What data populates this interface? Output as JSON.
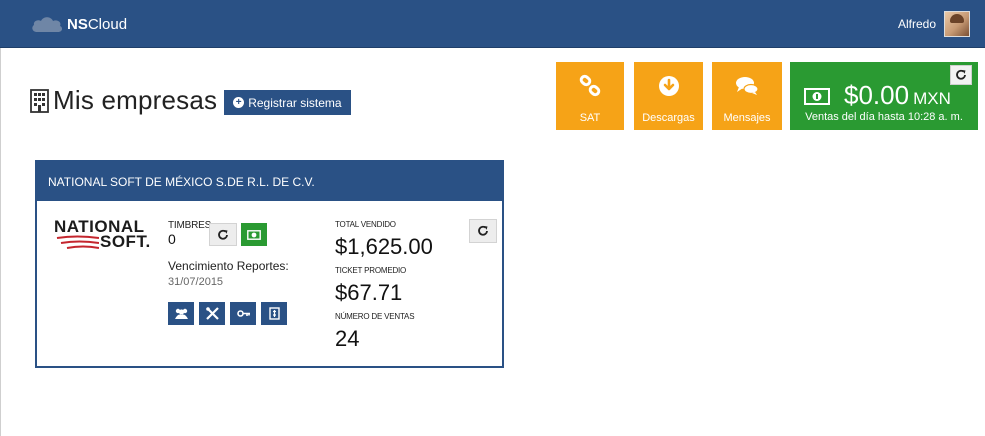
{
  "header": {
    "brand_prefix": "NS",
    "brand_suffix": "Cloud",
    "user_name": "Alfredo",
    "brand_color": "#2a5185"
  },
  "page": {
    "title": "Mis empresas",
    "register_button": "Registrar sistema"
  },
  "tiles": {
    "sat_label": "SAT",
    "downloads_label": "Descargas",
    "messages_label": "Mensajes",
    "tile_color": "#f6a317",
    "sales": {
      "amount": "$0.00",
      "currency": "MXN",
      "caption": "Ventas del día hasta 10:28 a. m.",
      "refresh_glyph": "C",
      "color": "#2a9a32"
    }
  },
  "company": {
    "name": "NATIONAL SOFT DE MÉXICO S.DE R.L. DE C.V.",
    "logo_top": "NATIONAL",
    "logo_bottom": "SOFT.",
    "timbres_label": "TIMBRES",
    "timbres_value": "0",
    "refresh_glyph": "C",
    "vencimiento_label": "Vencimiento Reportes:",
    "vencimiento_date": "31/07/2015",
    "total_vendido_label": "TOTAL VENDIDO",
    "total_vendido_value": "$1,625.00",
    "ticket_promedio_label": "TICKET PROMEDIO",
    "ticket_promedio_value": "$67.71",
    "numero_ventas_label": "NÚMERO DE VENTAS",
    "numero_ventas_value": "24",
    "action_icons": [
      "users-icon",
      "tools-icon",
      "key-icon",
      "report-icon"
    ]
  }
}
